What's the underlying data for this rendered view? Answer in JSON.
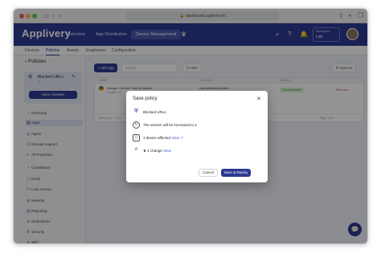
{
  "browser": {
    "url": "dashboard.applivery.io"
  },
  "header": {
    "brand": "Applivery",
    "nav": [
      "Overview",
      "App Distribution",
      "Device Management"
    ],
    "active_nav": "Device Management",
    "org_sub": "Workspace",
    "org_name": "Lab"
  },
  "subnav": {
    "tabs": [
      "Devices",
      "Policies",
      "Assets",
      "Employees",
      "Configuration"
    ],
    "active": "Policies"
  },
  "sidebar": {
    "back_label": "Policies",
    "policy_name": "Blocked URLs",
    "policy_version": "v1",
    "save_label": "Save changes",
    "items": [
      "Summary",
      "Apps",
      "Agent",
      "Remote support",
      "All Properties",
      "Compliance",
      "Kiosk",
      "Lock Screen",
      "Network",
      "Reporting",
      "Restrictions",
      "Security",
      "WiFi"
    ]
  },
  "main": {
    "add_app_label": "+ Add App",
    "search_placeholder": "Search",
    "filter_label": "Filter",
    "options_label": "Options",
    "table": {
      "headers": [
        "NAME",
        "PACKAGE",
        "INSTALL",
        ""
      ],
      "row": {
        "name": "Google Chrome: Fast & Secure",
        "name_sub": "Google LLC",
        "package": "com.android.chrome",
        "package_sub": "5014800",
        "status": "Force installed",
        "action": "Remove"
      },
      "footer_left": "Showing 1 - 1 of 1",
      "footer_right": "Page 1 of 1"
    }
  },
  "modal": {
    "title": "Save policy",
    "policy_name": "Blocked URLs",
    "version_text": "The version will be increased to 2",
    "devices_text": "1 device affected",
    "devices_link": "View",
    "changes_text": "1 change",
    "changes_link": "View",
    "cancel_label": "Cancel",
    "save_label": "Save & Deploy"
  }
}
